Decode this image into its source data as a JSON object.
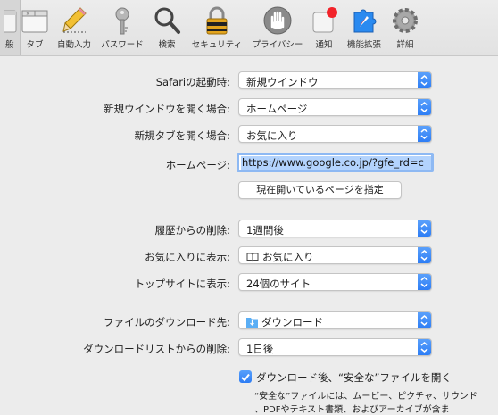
{
  "toolbar": {
    "tabs": [
      {
        "label": "般",
        "icon": "general-icon"
      },
      {
        "label": "タブ",
        "icon": "tabs-icon"
      },
      {
        "label": "自動入力",
        "icon": "pencil-icon"
      },
      {
        "label": "パスワード",
        "icon": "key-icon"
      },
      {
        "label": "検索",
        "icon": "magnifier-icon"
      },
      {
        "label": "セキュリティ",
        "icon": "lock-icon"
      },
      {
        "label": "プライバシー",
        "icon": "hand-icon"
      },
      {
        "label": "通知",
        "icon": "notification-icon"
      },
      {
        "label": "機能拡張",
        "icon": "puzzle-icon"
      },
      {
        "label": "詳細",
        "icon": "gear-icon"
      }
    ],
    "accent_color": "#2d7df5",
    "notification_color": "#f2232a"
  },
  "form": {
    "startup_label": "Safariの起動時:",
    "startup_value": "新規ウインドウ",
    "new_window_label": "新規ウインドウを開く場合:",
    "new_window_value": "ホームページ",
    "new_tab_label": "新規タブを開く場合:",
    "new_tab_value": "お気に入り",
    "homepage_label": "ホームページ:",
    "homepage_value": "https://www.google.co.jp/?gfe_rd=c",
    "set_current_button": "現在開いているページを指定",
    "remove_history_label": "履歴からの削除:",
    "remove_history_value": "1週間後",
    "favorites_label": "お気に入りに表示:",
    "favorites_value": "お気に入り",
    "top_sites_label": "トップサイトに表示:",
    "top_sites_value": "24個のサイト",
    "download_location_label": "ファイルのダウンロード先:",
    "download_location_value": "ダウンロード",
    "remove_downloads_label": "ダウンロードリストからの削除:",
    "remove_downloads_value": "1日後",
    "open_safe_files_label": "ダウンロード後、“安全な”ファイルを開く",
    "open_safe_files_checked": true,
    "safe_files_desc_1": "“安全な”ファイルには、ムービー、ピクチャ、サウンド",
    "safe_files_desc_2": "、PDFやテキスト書類、およびアーカイブが含ま"
  }
}
